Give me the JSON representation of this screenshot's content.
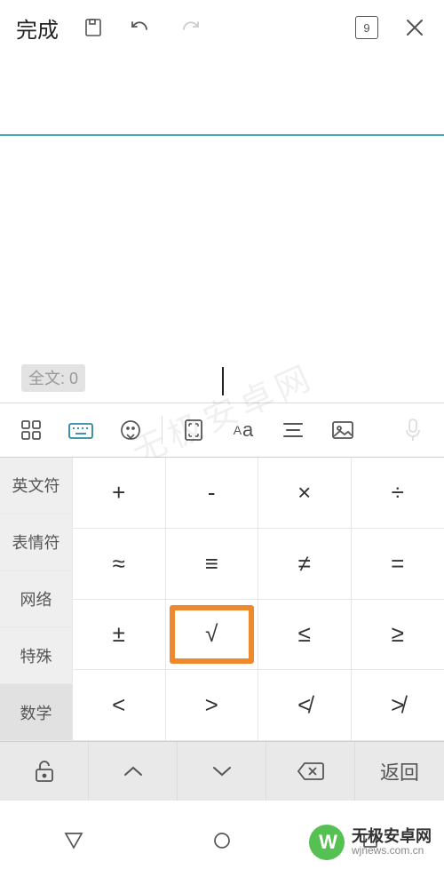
{
  "topbar": {
    "done_label": "完成",
    "page_number": "9"
  },
  "editor": {
    "wordcount_label": "全文: 0"
  },
  "categories": [
    {
      "label": "英文符"
    },
    {
      "label": "表情符"
    },
    {
      "label": "网络"
    },
    {
      "label": "特殊"
    },
    {
      "label": "数学",
      "selected": true
    }
  ],
  "symbols": [
    "+",
    "-",
    "×",
    "÷",
    "≈",
    "≡",
    "≠",
    "=",
    "±",
    "√",
    "≤",
    "≥",
    "<",
    ">",
    "≮",
    "≯"
  ],
  "highlight_index": 9,
  "botbar": {
    "back_label": "返回"
  },
  "watermark": {
    "logo_text": "W",
    "title": "无极安卓网",
    "subtitle": "wjnews.com.cn"
  },
  "diagonal_watermark": "无极安卓网"
}
